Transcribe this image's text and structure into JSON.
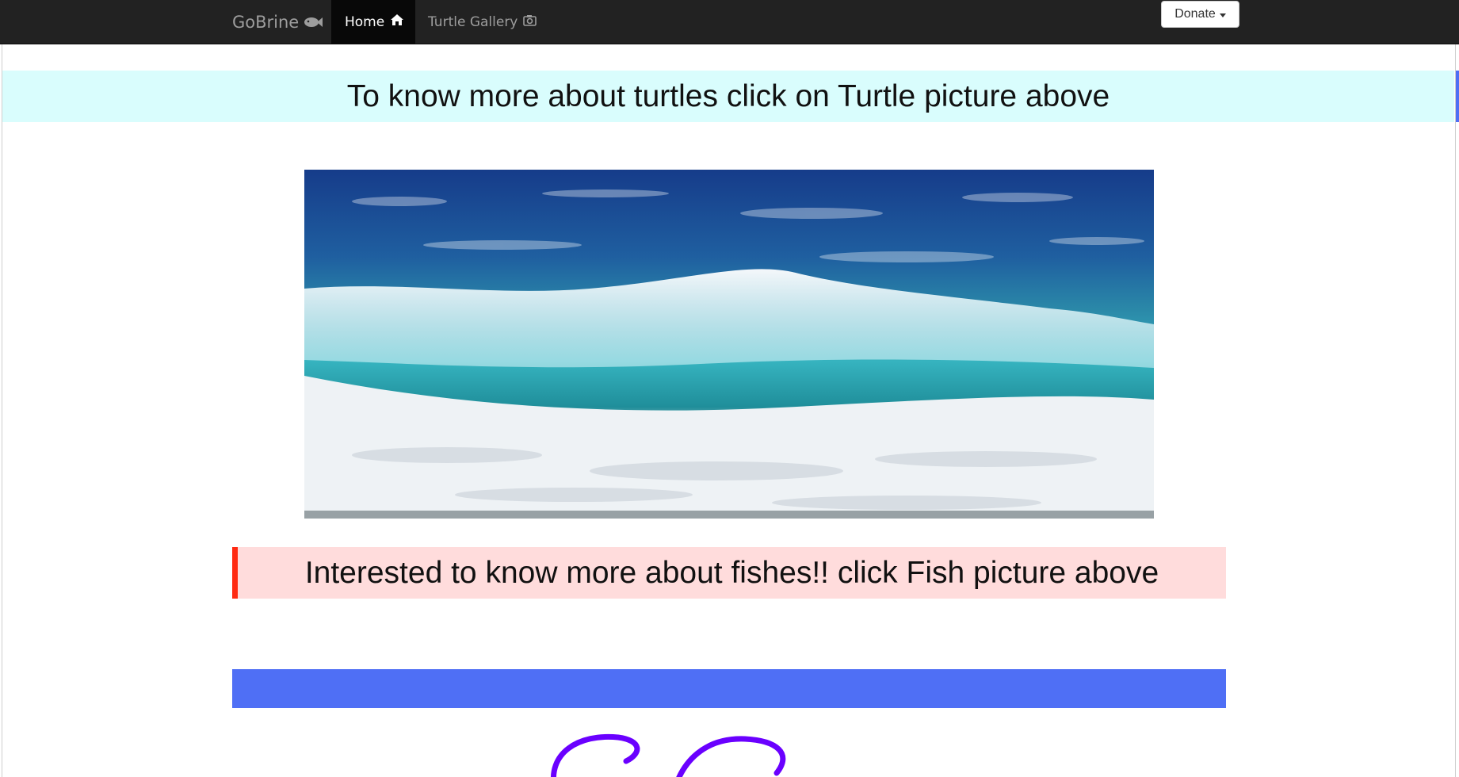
{
  "navbar": {
    "brand_label": "GoBrine",
    "brand_icon": "fish-icon",
    "items": [
      {
        "label": "Home",
        "icon": "home-icon",
        "active": true
      },
      {
        "label": "Turtle Gallery",
        "icon": "camera-icon",
        "active": false
      }
    ],
    "donate_label": "Donate"
  },
  "main": {
    "turtle_banner_text": "To know more about turtles click on Turtle picture above",
    "fish_banner_text": "Interested to know more about fishes!! click Fish picture above"
  },
  "colors": {
    "navbar_bg": "#222222",
    "turtle_banner_bg": "#d9fdfd",
    "fish_banner_bg": "#ffdcdc",
    "fish_banner_accent": "#ff2a12",
    "blue_bar": "#4f6ff5",
    "logo_script": "#6a00ff"
  }
}
